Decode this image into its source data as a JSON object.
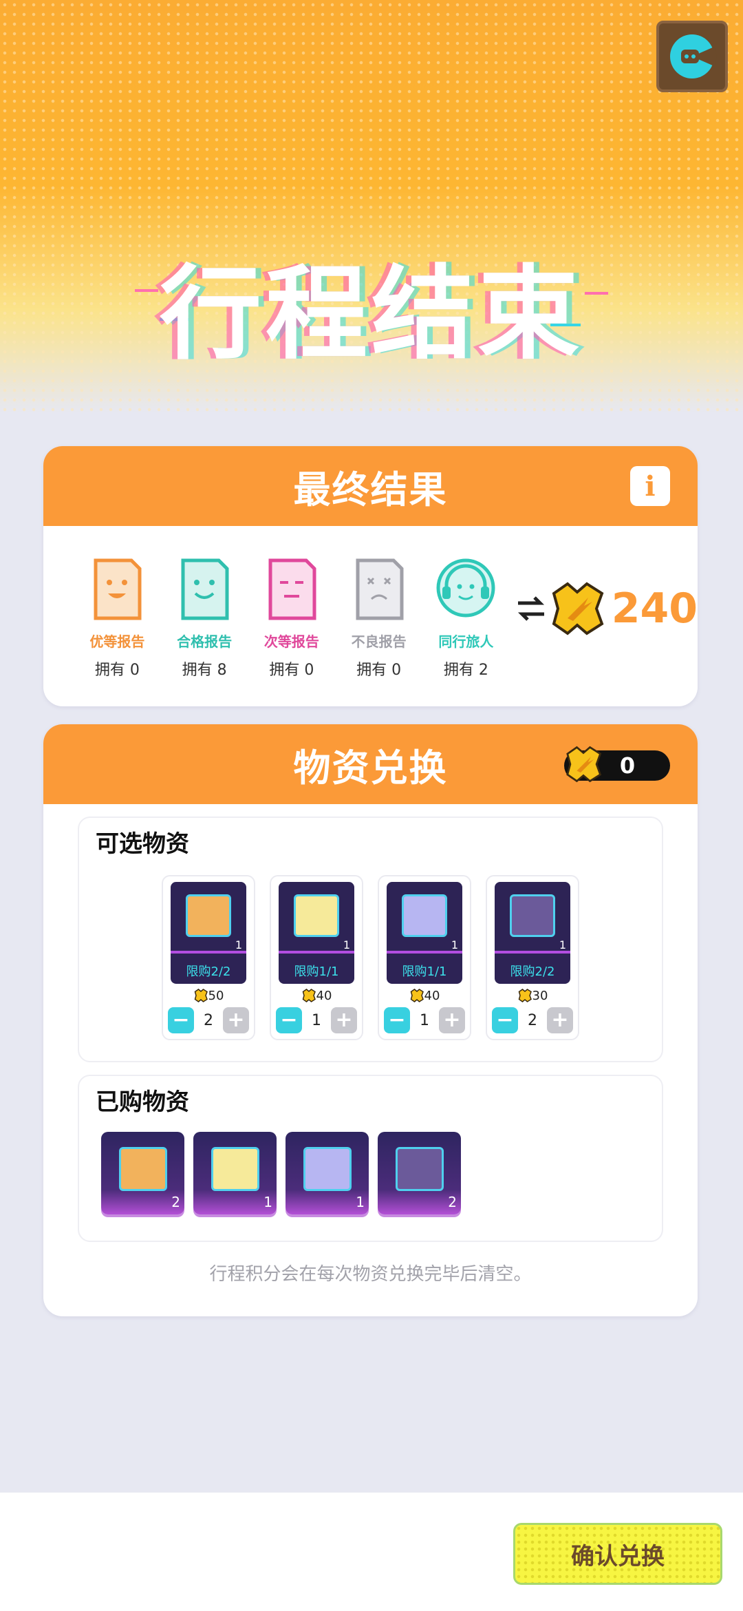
{
  "hero": {
    "title": "行程结束"
  },
  "colors": {
    "accent": "#fb9a38",
    "teal": "#38d0e0",
    "confirm_bg": "#f7f542"
  },
  "result": {
    "title": "最终结果",
    "info_icon": "i",
    "reports": [
      {
        "label": "优等报告",
        "owned": "拥有 0",
        "color": "#f3923a",
        "icon": "happy-report-icon"
      },
      {
        "label": "合格报告",
        "owned": "拥有 8",
        "color": "#2fbfae",
        "icon": "smile-report-icon"
      },
      {
        "label": "次等报告",
        "owned": "拥有 0",
        "color": "#e0489b",
        "icon": "meh-report-icon"
      },
      {
        "label": "不良报告",
        "owned": "拥有 0",
        "color": "#a0a0a8",
        "icon": "sad-report-icon"
      },
      {
        "label": "同行旅人",
        "owned": "拥有 2",
        "color": "#2fc8b8",
        "icon": "headset-traveler-icon"
      }
    ],
    "exchange_icon": "exchange-arrows-icon",
    "points": "240"
  },
  "supply": {
    "title": "物资兑换",
    "balance": "0",
    "selectable_title": "可选物资",
    "items": [
      {
        "limit": "限购2/2",
        "count": "1",
        "price": "50",
        "qty": "2"
      },
      {
        "limit": "限购1/1",
        "count": "1",
        "price": "40",
        "qty": "1"
      },
      {
        "limit": "限购1/1",
        "count": "1",
        "price": "40",
        "qty": "1"
      },
      {
        "limit": "限购2/2",
        "count": "1",
        "price": "30",
        "qty": "2"
      }
    ],
    "purchased_title": "已购物资",
    "purchased": [
      {
        "count": "2"
      },
      {
        "count": "1"
      },
      {
        "count": "1"
      },
      {
        "count": "2"
      }
    ],
    "note": "行程积分会在每次物资兑换完毕后清空。"
  },
  "footer": {
    "confirm_label": "确认兑换"
  }
}
